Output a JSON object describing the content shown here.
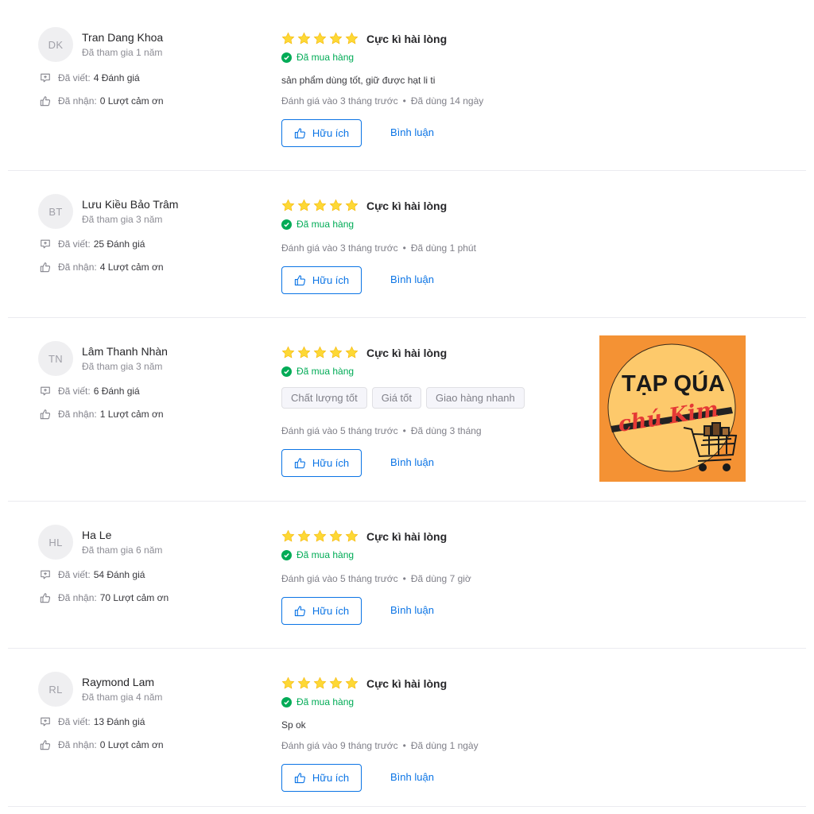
{
  "colors": {
    "accent": "#0b74e5",
    "bought_green": "#00ab56",
    "star": "#fdd835"
  },
  "icons": {
    "written": "comment-icon",
    "received": "thumbs-up-icon",
    "star": "star-icon",
    "check": "check-circle-icon"
  },
  "labels": {
    "written": "Đã viết:",
    "received": "Đã nhận:",
    "bought": "Đã mua hàng",
    "helpful": "Hữu ích",
    "comment": "Bình luận"
  },
  "reviews": [
    {
      "initials": "DK",
      "name": "Tran Dang Khoa",
      "joined": "Đã tham gia 1 năm",
      "written": "4 Đánh giá",
      "received": "0 Lượt cảm ơn",
      "stars": 5,
      "rating_title": "Cực kì hài lòng",
      "text": "sản phẩm dùng tốt, giữ được hạt li ti",
      "reviewed_ago": "Đánh giá vào 3 tháng trước",
      "used_for": "Đã dùng 14 ngày"
    },
    {
      "initials": "BT",
      "name": "Lưu Kiều Bảo Trâm",
      "joined": "Đã tham gia 3 năm",
      "written": "25 Đánh giá",
      "received": "4 Lượt cảm ơn",
      "stars": 5,
      "rating_title": "Cực kì hài lòng",
      "reviewed_ago": "Đánh giá vào 3 tháng trước",
      "used_for": "Đã dùng 1 phút"
    },
    {
      "initials": "TN",
      "name": "Lâm Thanh Nhàn",
      "joined": "Đã tham gia 3 năm",
      "written": "6 Đánh giá",
      "received": "1 Lượt cảm ơn",
      "stars": 5,
      "rating_title": "Cực kì hài lòng",
      "tags": [
        "Chất lượng tốt",
        "Giá tốt",
        "Giao hàng nhanh"
      ],
      "reviewed_ago": "Đánh giá vào 5 tháng trước",
      "used_for": "Đã dùng 3 tháng",
      "photo": {
        "line1": "TẠP QÚA",
        "line2": "chú Kim"
      }
    },
    {
      "initials": "HL",
      "name": "Ha Le",
      "joined": "Đã tham gia 6 năm",
      "written": "54 Đánh giá",
      "received": "70 Lượt cảm ơn",
      "stars": 5,
      "rating_title": "Cực kì hài lòng",
      "reviewed_ago": "Đánh giá vào 5 tháng trước",
      "used_for": "Đã dùng 7 giờ"
    },
    {
      "initials": "RL",
      "name": "Raymond Lam",
      "joined": "Đã tham gia 4 năm",
      "written": "13 Đánh giá",
      "received": "0 Lượt cảm ơn",
      "stars": 5,
      "rating_title": "Cực kì hài lòng",
      "text": "Sp ok",
      "reviewed_ago": "Đánh giá vào 9 tháng trước",
      "used_for": "Đã dùng 1 ngày"
    }
  ]
}
